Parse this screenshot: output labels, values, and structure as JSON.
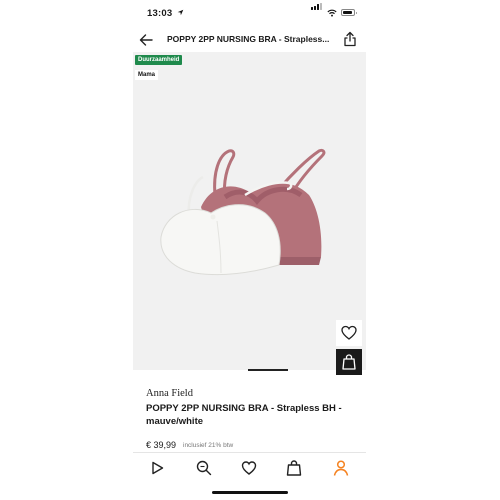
{
  "status_bar": {
    "time": "13:03"
  },
  "header": {
    "title": "POPPY 2PP NURSING BRA - Strapless..."
  },
  "badges": {
    "sustainability": "Duurzaamheid",
    "category": "Mama"
  },
  "product": {
    "brand": "Anna Field",
    "name": "POPPY 2PP NURSING BRA - Strapless BH - mauve/white",
    "price": "€ 39,99",
    "vat_note": "inclusief 21% btw"
  },
  "colors": {
    "accent": "#f58220",
    "badge_green": "#1f8a4c",
    "mauve": "#b4727a",
    "white_bra": "#f7f7f5"
  },
  "tabbar": {
    "items": [
      "play-icon",
      "search-icon",
      "heart-icon",
      "bag-icon",
      "profile-icon"
    ],
    "active": "profile-icon"
  }
}
